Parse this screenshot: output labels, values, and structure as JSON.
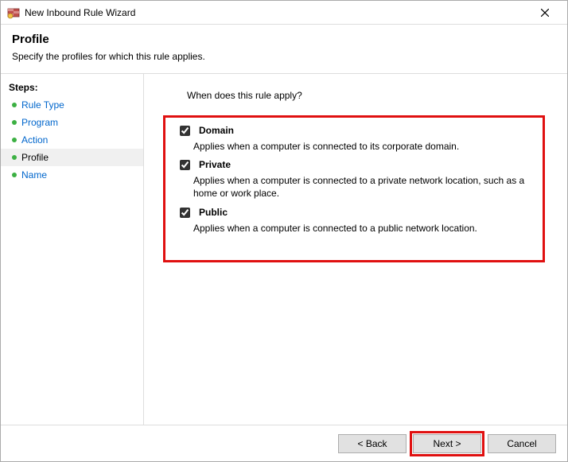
{
  "title": "New Inbound Rule Wizard",
  "header": {
    "title": "Profile",
    "subtitle": "Specify the profiles for which this rule applies."
  },
  "sidebar": {
    "title": "Steps:",
    "items": [
      {
        "label": "Rule Type",
        "current": false
      },
      {
        "label": "Program",
        "current": false
      },
      {
        "label": "Action",
        "current": false
      },
      {
        "label": "Profile",
        "current": true
      },
      {
        "label": "Name",
        "current": false
      }
    ]
  },
  "content": {
    "prompt": "When does this rule apply?",
    "checkboxes": [
      {
        "label": "Domain",
        "checked": true,
        "desc": "Applies when a computer is connected to its corporate domain."
      },
      {
        "label": "Private",
        "checked": true,
        "desc": "Applies when a computer is connected to a private network location, such as a home or work place."
      },
      {
        "label": "Public",
        "checked": true,
        "desc": "Applies when a computer is connected to a public network location."
      }
    ]
  },
  "footer": {
    "back": "< Back",
    "next": "Next >",
    "cancel": "Cancel"
  }
}
